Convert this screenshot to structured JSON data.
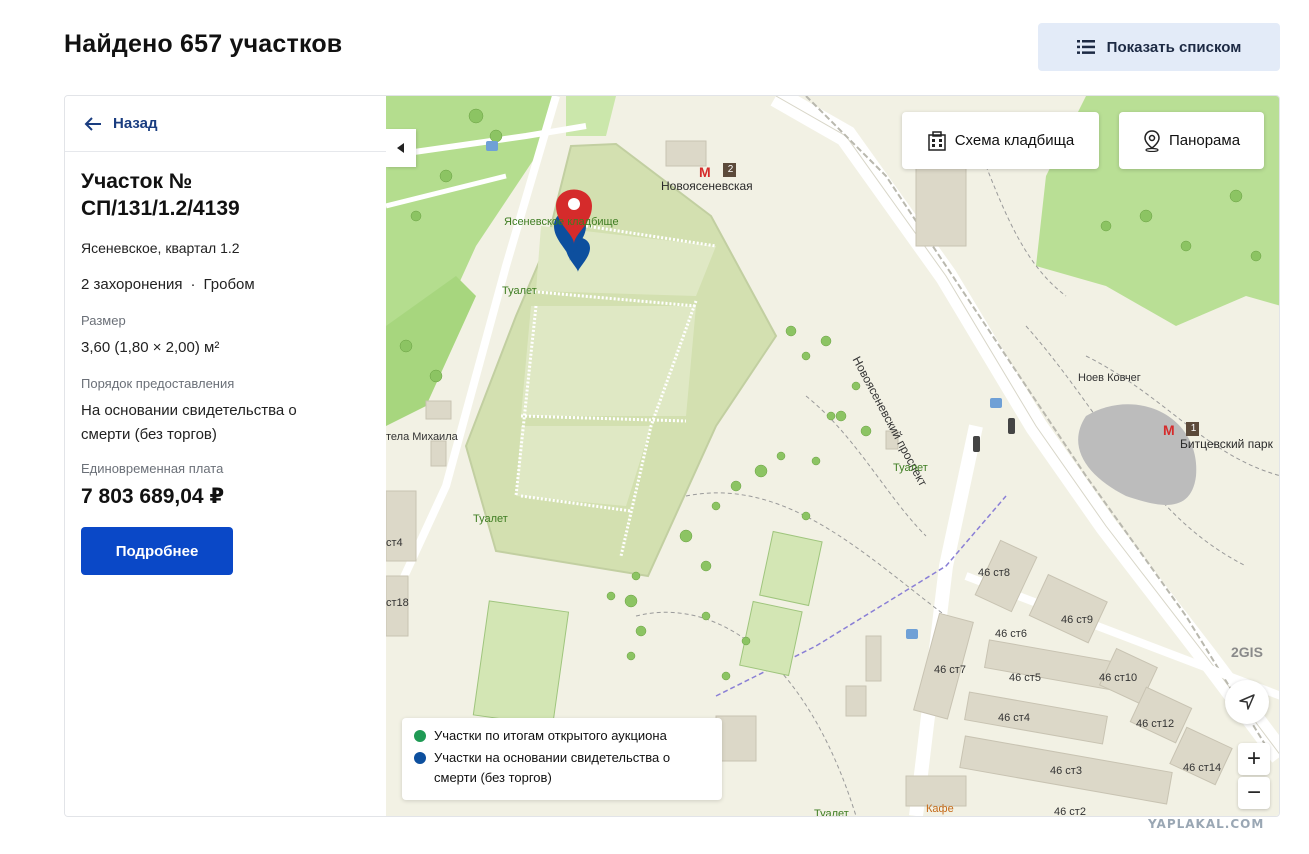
{
  "header": {
    "title": "Найдено 657 участков",
    "list_button": "Показать списком"
  },
  "sidebar": {
    "back": "Назад",
    "plot_title": "Участок № СП/131/1.2/4139",
    "address": "Ясеневское, квартал 1.2",
    "burials": "2 захоронения",
    "burial_type": "Гробом",
    "separator": "·",
    "size_label": "Размер",
    "size_value": "3,60 (1,80 × 2,00) м²",
    "order_label": "Порядок предоставления",
    "order_value": "На основании свидетельства о смерти (без торгов)",
    "fee_label": "Единовременная плата",
    "fee_value": "7 803 689,04 ₽",
    "details_button": "Подробнее"
  },
  "map": {
    "scheme_button": "Схема кладбища",
    "panorama_button": "Панорама",
    "legend": [
      {
        "label": "Участки по итогам открытого аукциона",
        "color": "#1f9a55"
      },
      {
        "label": "Участки на основании свидетельства о смерти (без торгов)",
        "color": "#0d4f9e"
      }
    ],
    "zoom_in": "+",
    "zoom_out": "−",
    "brand": "2GIS",
    "labels": {
      "cemetery": "Ясеневское кладбище",
      "metro1": "Новоясеневская",
      "metro1_line": "2",
      "metro2": "Битцевский парк",
      "metro2_line": "1",
      "avenue": "Новоясеневский проспект",
      "church": "Ноев Ковчег",
      "toilet1": "Туалет",
      "toilet2": "Туалет",
      "toilet3": "Туалет",
      "toilet4": "Туалет",
      "chapel": "тела Михаила",
      "cafe": "Кафе",
      "b_st4": "ст4",
      "b_st18": "ст18",
      "b46_8": "46 ст8",
      "b46_6": "46 ст6",
      "b46_9": "46 ст9",
      "b46_7": "46 ст7",
      "b46_5": "46 ст5",
      "b46_10": "46 ст10",
      "b46_4": "46 ст4",
      "b46_12": "46 ст12",
      "b46_3": "46 ст3",
      "b46_14": "46 ст14",
      "b46_2": "46 ст2"
    }
  },
  "watermark": "YAPLAKAL.COM"
}
